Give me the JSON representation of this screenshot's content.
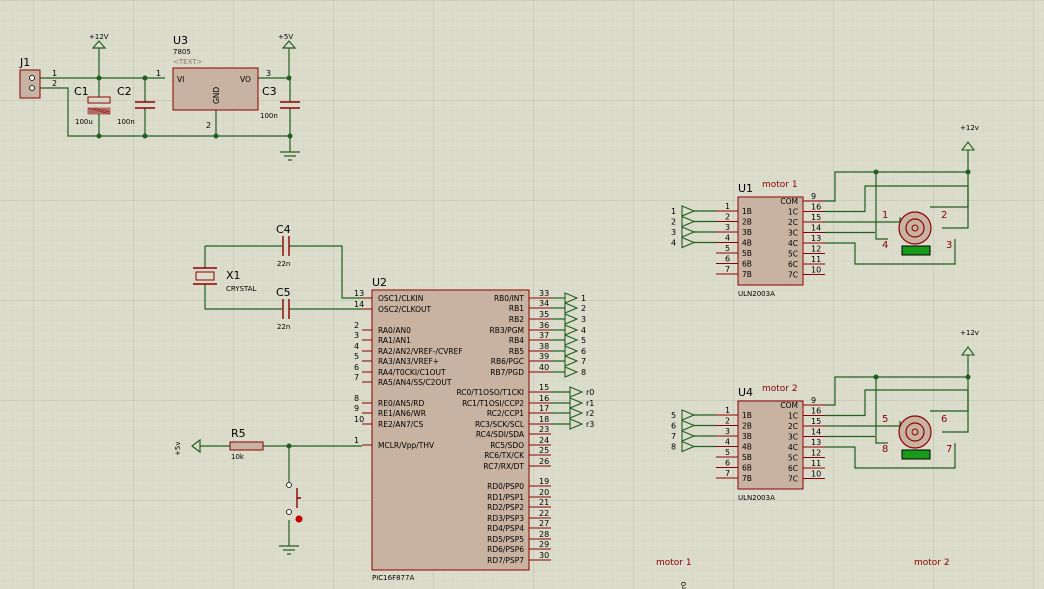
{
  "colors": {
    "wire": "#1f5f1f",
    "component": "#8b0000",
    "body": "#c8b3a2",
    "grid": "#c7c7b8",
    "background": "#dcdccc"
  },
  "power": {
    "j1": "J1",
    "j1_pins": [
      "1",
      "2"
    ],
    "c1": "C1",
    "c1_val": "100u",
    "c2": "C2",
    "c2_val": "100n",
    "c3": "C3",
    "c3_val": "100n",
    "u3": "U3",
    "u3_part": "7805",
    "u3_text": "<TEXT>",
    "u3_vi": "VI",
    "u3_vo": "VO",
    "u3_gnd": "GND",
    "u3_pins": [
      "1",
      "3",
      "2"
    ],
    "p12": "+12V",
    "p5": "+5V"
  },
  "osc": {
    "c4": "C4",
    "c4_val": "22n",
    "c5": "C5",
    "c5_val": "22n",
    "x1": "X1",
    "x1_val": "CRYSTAL"
  },
  "reset": {
    "r5": "R5",
    "r5_val": "10k",
    "plus5": "+5v"
  },
  "mcu": {
    "ref": "U2",
    "part": "PIC16F877A",
    "left_pins": [
      {
        "num": "13",
        "label": "OSC1/CLKIN"
      },
      {
        "num": "14",
        "label": "OSC2/CLKOUT"
      },
      {
        "num": "2",
        "label": "RA0/AN0"
      },
      {
        "num": "3",
        "label": "RA1/AN1"
      },
      {
        "num": "4",
        "label": "RA2/AN2/VREF-/CVREF"
      },
      {
        "num": "5",
        "label": "RA3/AN3/VREF+"
      },
      {
        "num": "6",
        "label": "RA4/T0CKI/C1OUT"
      },
      {
        "num": "7",
        "label": "RA5/AN4/SS/C2OUT"
      },
      {
        "num": "8",
        "label": "RE0/AN5/RD"
      },
      {
        "num": "9",
        "label": "RE1/AN6/WR"
      },
      {
        "num": "10",
        "label": "RE2/AN7/CS"
      },
      {
        "num": "1",
        "label": "MCLR/Vpp/THV"
      }
    ],
    "right_pins": [
      {
        "num": "33",
        "label": "RB0/INT",
        "net": "1"
      },
      {
        "num": "34",
        "label": "RB1",
        "net": "2"
      },
      {
        "num": "35",
        "label": "RB2",
        "net": "3"
      },
      {
        "num": "36",
        "label": "RB3/PGM",
        "net": "4"
      },
      {
        "num": "37",
        "label": "RB4",
        "net": "5"
      },
      {
        "num": "38",
        "label": "RB5",
        "net": "6"
      },
      {
        "num": "39",
        "label": "RB6/PGC",
        "net": "7"
      },
      {
        "num": "40",
        "label": "RB7/PGD",
        "net": "8"
      },
      {
        "num": "15",
        "label": "RC0/T1OSO/T1CKI",
        "net": "r0"
      },
      {
        "num": "16",
        "label": "RC1/T1OSI/CCP2",
        "net": "r1"
      },
      {
        "num": "17",
        "label": "RC2/CCP1",
        "net": "r2"
      },
      {
        "num": "18",
        "label": "RC3/SCK/SCL",
        "net": "r3"
      },
      {
        "num": "23",
        "label": "RC4/SDI/SDA",
        "net": ""
      },
      {
        "num": "24",
        "label": "RC5/SDO",
        "net": ""
      },
      {
        "num": "25",
        "label": "RC6/TX/CK",
        "net": ""
      },
      {
        "num": "26",
        "label": "RC7/RX/DT",
        "net": ""
      },
      {
        "num": "19",
        "label": "RD0/PSP0",
        "net": ""
      },
      {
        "num": "20",
        "label": "RD1/PSP1",
        "net": ""
      },
      {
        "num": "21",
        "label": "RD2/PSP2",
        "net": ""
      },
      {
        "num": "22",
        "label": "RD3/PSP3",
        "net": ""
      },
      {
        "num": "27",
        "label": "RD4/PSP4",
        "net": ""
      },
      {
        "num": "28",
        "label": "RD5/PSP5",
        "net": ""
      },
      {
        "num": "29",
        "label": "RD6/PSP6",
        "net": ""
      },
      {
        "num": "30",
        "label": "RD7/PSP7",
        "net": ""
      }
    ]
  },
  "drivers": [
    {
      "ref": "U1",
      "title": "motor 1",
      "part": "ULN2003A",
      "supply": "+12v",
      "in_nets": [
        "1",
        "2",
        "3",
        "4"
      ],
      "left_pins": [
        {
          "num": "1",
          "label": "1B"
        },
        {
          "num": "2",
          "label": "2B"
        },
        {
          "num": "3",
          "label": "3B"
        },
        {
          "num": "4",
          "label": "4B"
        },
        {
          "num": "5",
          "label": "5B"
        },
        {
          "num": "6",
          "label": "6B"
        },
        {
          "num": "7",
          "label": "7B"
        }
      ],
      "right_pins": [
        {
          "num": "9",
          "label": "COM"
        },
        {
          "num": "16",
          "label": "1C"
        },
        {
          "num": "15",
          "label": "2C"
        },
        {
          "num": "14",
          "label": "3C"
        },
        {
          "num": "13",
          "label": "4C"
        },
        {
          "num": "12",
          "label": "5C"
        },
        {
          "num": "11",
          "label": "6C"
        },
        {
          "num": "10",
          "label": "7C"
        }
      ],
      "motor_pins": [
        "1",
        "2",
        "4",
        "3"
      ]
    },
    {
      "ref": "U4",
      "title": "motor 2",
      "part": "ULN2003A",
      "supply": "+12v",
      "in_nets": [
        "5",
        "6",
        "7",
        "8"
      ],
      "left_pins": [
        {
          "num": "1",
          "label": "1B"
        },
        {
          "num": "2",
          "label": "2B"
        },
        {
          "num": "3",
          "label": "3B"
        },
        {
          "num": "4",
          "label": "4B"
        },
        {
          "num": "5",
          "label": "5B"
        },
        {
          "num": "6",
          "label": "6B"
        },
        {
          "num": "7",
          "label": "7B"
        }
      ],
      "right_pins": [
        {
          "num": "9",
          "label": "COM"
        },
        {
          "num": "16",
          "label": "1C"
        },
        {
          "num": "15",
          "label": "2C"
        },
        {
          "num": "14",
          "label": "3C"
        },
        {
          "num": "13",
          "label": "4C"
        },
        {
          "num": "12",
          "label": "5C"
        },
        {
          "num": "11",
          "label": "6C"
        },
        {
          "num": "10",
          "label": "7C"
        }
      ],
      "motor_pins": [
        "5",
        "6",
        "8",
        "7"
      ]
    }
  ],
  "bottom": {
    "motor1": "motor 1",
    "motor2": "motor 2",
    "r0": "r0"
  }
}
